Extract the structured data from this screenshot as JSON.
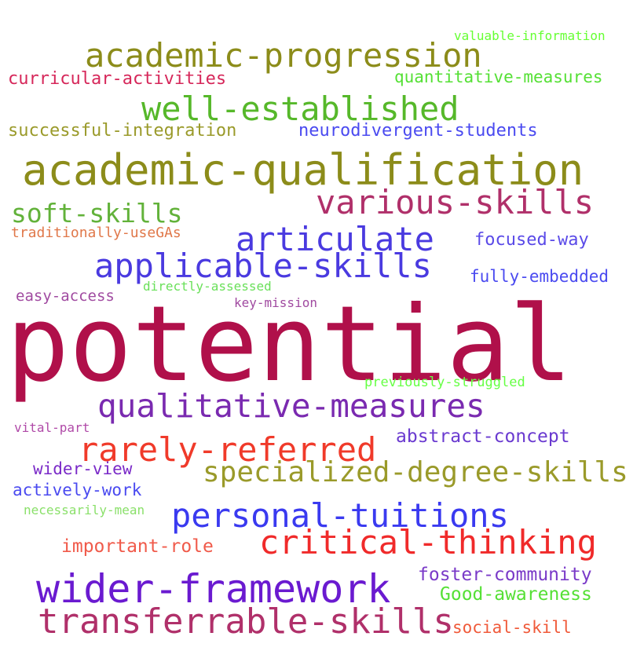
{
  "words": [
    {
      "text": "valuable-information",
      "color": "#66ff33"
    },
    {
      "text": "academic-progression",
      "color": "#8c8c1a"
    },
    {
      "text": "curricular-activities",
      "color": "#d6275a"
    },
    {
      "text": "quantitative-measures",
      "color": "#55e035"
    },
    {
      "text": "well-established",
      "color": "#56b82a"
    },
    {
      "text": "successful-integration",
      "color": "#9a9a2a"
    },
    {
      "text": "neurodivergent-students",
      "color": "#4a4af0"
    },
    {
      "text": "academic-qualification",
      "color": "#8c8c1a"
    },
    {
      "text": "various-skills",
      "color": "#b0306a"
    },
    {
      "text": "soft-skills",
      "color": "#62b23a"
    },
    {
      "text": "traditionally-useGAs",
      "color": "#e0784a"
    },
    {
      "text": "articulate",
      "color": "#4a3ae0"
    },
    {
      "text": "focused-way",
      "color": "#5a4ae8"
    },
    {
      "text": "applicable-skills",
      "color": "#4a3ae0"
    },
    {
      "text": "fully-embedded",
      "color": "#4a4af0"
    },
    {
      "text": "easy-access",
      "color": "#a04aa0"
    },
    {
      "text": "directly-assessed",
      "color": "#6ae05a"
    },
    {
      "text": "key-mission",
      "color": "#a04aa0"
    },
    {
      "text": "potential",
      "color": "#b0104a"
    },
    {
      "text": "previously-struggled",
      "color": "#66ff44"
    },
    {
      "text": "qualitative-measures",
      "color": "#7a2ab0"
    },
    {
      "text": "vital-part",
      "color": "#b04aa8"
    },
    {
      "text": "abstract-concept",
      "color": "#6a3ad0"
    },
    {
      "text": "rarely-referred",
      "color": "#f03a2a"
    },
    {
      "text": "wider-view",
      "color": "#7a2ac8"
    },
    {
      "text": "specialized-degree-skills",
      "color": "#9a9a2a"
    },
    {
      "text": "actively-work",
      "color": "#4a4af0"
    },
    {
      "text": "necessarily-mean",
      "color": "#8ae06a"
    },
    {
      "text": "personal-tuitions",
      "color": "#3a3af0"
    },
    {
      "text": "important-role",
      "color": "#f05a4a"
    },
    {
      "text": "critical-thinking",
      "color": "#f02a2a"
    },
    {
      "text": "foster-community",
      "color": "#7a3ac8"
    },
    {
      "text": "wider-framework",
      "color": "#6a1ad0"
    },
    {
      "text": "Good-awareness",
      "color": "#55e035"
    },
    {
      "text": "transferrable-skills",
      "color": "#b0306a"
    },
    {
      "text": "social-skill",
      "color": "#f05a3a"
    }
  ]
}
